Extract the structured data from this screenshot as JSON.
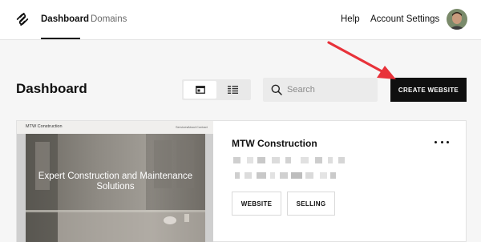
{
  "nav": {
    "tabs": [
      {
        "label": "Dashboard",
        "active": true
      },
      {
        "label": "Domains",
        "active": false
      }
    ],
    "help_label": "Help",
    "account_label": "Account Settings"
  },
  "header": {
    "title": "Dashboard",
    "view_modes": [
      "grid-view-icon",
      "list-view-icon"
    ],
    "active_view": "grid",
    "search": {
      "placeholder": "Search",
      "value": ""
    },
    "create_button_label": "CREATE WEBSITE"
  },
  "site_card": {
    "thumbnail": {
      "site_name": "MTW Construction",
      "nav_items": [
        "Services",
        "About",
        "Contact"
      ],
      "headline": "Expert Construction and Maintenance Solutions"
    },
    "title": "MTW Construction",
    "actions": [
      "WEBSITE",
      "SELLING"
    ],
    "menu_icon": "more-horizontal-icon"
  },
  "colors": {
    "annotation_arrow": "#e8323a",
    "primary_button": "#0f0f0f"
  }
}
